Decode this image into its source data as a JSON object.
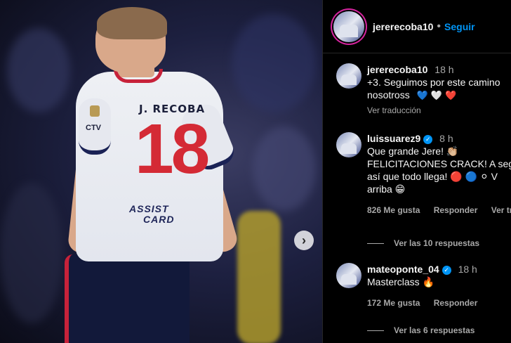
{
  "post": {
    "author": "jererecoba10",
    "follow_label": "Seguir",
    "separator": "•",
    "photo": {
      "jersey_name": "J. RECOBA",
      "jersey_number": "18",
      "sponsor_line1": "ASSIST",
      "sponsor_line2": "CARD",
      "chest_text": "CTV"
    }
  },
  "caption": {
    "user": "jererecoba10",
    "time": "18 h",
    "line1": "+3. Seguimos por este camino",
    "line2": "nosotross",
    "emojis": "💙 🤍 ❤️",
    "translate": "Ver traducción"
  },
  "comments": [
    {
      "user": "luissuarez9",
      "verified": true,
      "time": "8 h",
      "lines": [
        "Que grande Jere! 👏🏼",
        "FELICITACIONES CRACK! A seg",
        "así que todo llega! 🔴 🔵 ⚪ V",
        "arriba 😁"
      ],
      "likes": "826 Me gusta",
      "reply": "Responder",
      "translate": "Ver tr",
      "replies": "Ver las 10 respuestas"
    },
    {
      "user": "mateoponte_04",
      "verified": true,
      "time": "18 h",
      "lines": [
        "Masterclass 🔥"
      ],
      "likes": "172 Me gusta",
      "reply": "Responder",
      "replies": "Ver las 6 respuestas"
    }
  ],
  "colors": {
    "accent": "#0095f6",
    "muted": "#a8a8a8",
    "jersey_red": "#d42a35"
  }
}
